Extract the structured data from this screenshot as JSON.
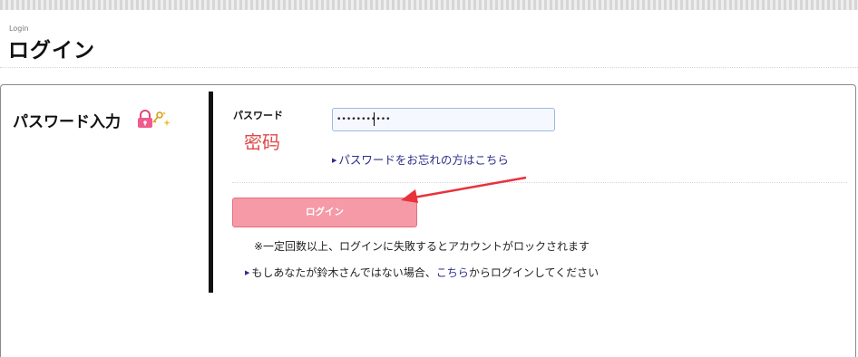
{
  "header": {
    "small_label": "Login",
    "title": "ログイン"
  },
  "section": {
    "heading": "パスワード入力",
    "icon": "lock-with-key-icon"
  },
  "form": {
    "password_label": "パスワード",
    "password_annotation": "密码",
    "password_value": "•••••••••••",
    "forgot_link": "パスワードをお忘れの方はこちら",
    "login_button": "ログイン"
  },
  "notes": {
    "lock_warning": "※一定回数以上、ログインに失敗するとアカウントがロックされます",
    "not_me_prefix": "もしあなたが鈴木さんではない場合、",
    "not_me_link": "こちら",
    "not_me_suffix": "からログインしてください"
  },
  "colors": {
    "login_button_bg": "#f59aa6",
    "link": "#2d2d8a",
    "annotation": "#e04848",
    "arrow": "#e8323c"
  }
}
